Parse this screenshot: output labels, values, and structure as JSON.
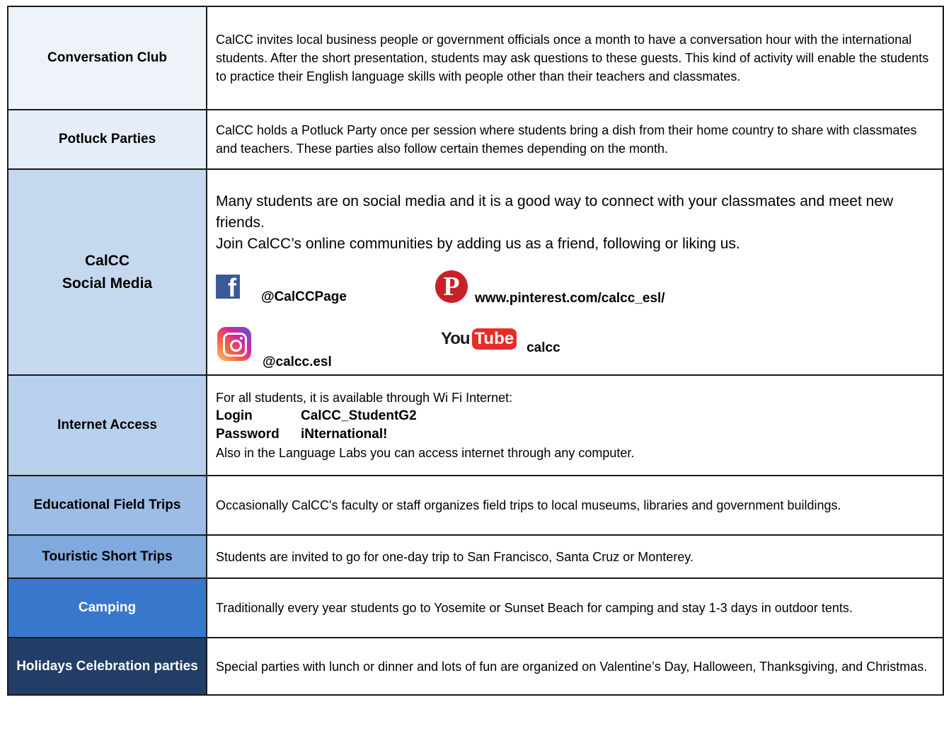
{
  "rows": [
    {
      "label": "Conversation Club",
      "text": "CalCC invites local business people or government officials once a month to have a conversation hour with the international students. After the short presentation, students may ask questions to these guests. This kind of activity will enable the students to practice their English language skills with people other than their teachers and classmates."
    },
    {
      "label": "Potluck Parties",
      "text": "CalCC holds a Potluck Party once per session where students bring a dish from their home country to share with classmates and teachers. These parties also follow certain themes depending on the month."
    },
    {
      "label_line1": "CalCC",
      "label_line2": "Social Media",
      "intro": "Many students are on social media and it is a good way to connect with your classmates and meet new friends.",
      "join": "Join CalCC’s online communities by adding us as a friend, following or liking us.",
      "facebook": "@CalCCPage",
      "pinterest": "www.pinterest.com/calcc_esl/",
      "instagram": "@calcc.esl",
      "youtube": "calcc",
      "youtube_logo_you": "You",
      "youtube_logo_tube": "Tube",
      "icons": [
        "facebook-icon",
        "pinterest-icon",
        "instagram-icon",
        "youtube-icon"
      ]
    },
    {
      "label": "Internet Access",
      "intro": "For all students, it is available through Wi Fi Internet:",
      "login_key": "Login",
      "login_value": "CalCC_StudentG2",
      "password_key": "Password",
      "password_value": "iNternational!",
      "note": "Also in the Language Labs you can access internet through any computer."
    },
    {
      "label": "Educational Field Trips",
      "text": "Occasionally CalCC's faculty or staff organizes field trips to local museums, libraries and government buildings."
    },
    {
      "label": "Touristic Short Trips",
      "text": "Students are invited to go for one-day trip to San Francisco, Santa Cruz or Monterey."
    },
    {
      "label": "Camping",
      "text": "Traditionally every year students go to Yosemite or Sunset Beach for camping and stay 1-3 days in outdoor tents."
    },
    {
      "label": "Holidays Celebration parties",
      "text": "Special parties with lunch or dinner and lots of fun are organized on Valentine’s Day, Halloween, Thanksgiving, and Christmas."
    }
  ]
}
